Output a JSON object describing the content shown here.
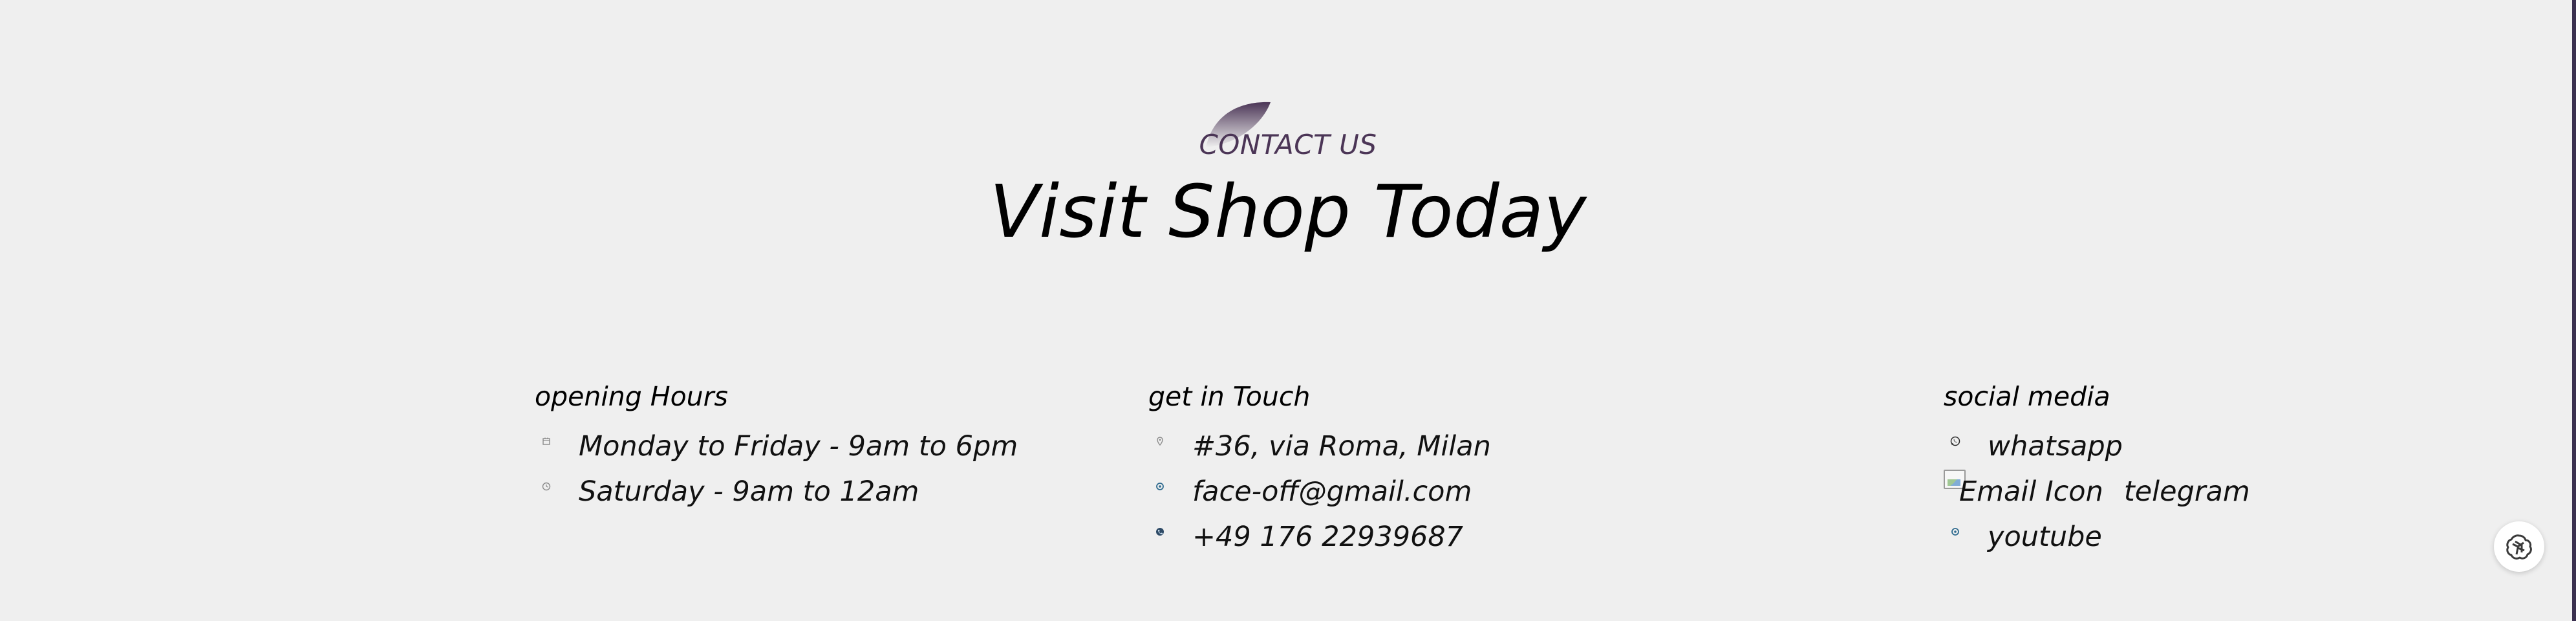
{
  "header": {
    "eyebrow": "CONTACT US",
    "title": "Visit Shop Today"
  },
  "columns": {
    "hours": {
      "heading": "opening Hours",
      "items": [
        {
          "icon": "calendar-icon",
          "text": "Monday to Friday - 9am to 6pm"
        },
        {
          "icon": "clock-icon",
          "text": "Saturday - 9am to 12am"
        }
      ]
    },
    "touch": {
      "heading": "get in Touch",
      "items": [
        {
          "icon": "location-pin-icon",
          "text": "#36, via Roma, Milan"
        },
        {
          "icon": "email-icon",
          "text": "face-off@gmail.com"
        },
        {
          "icon": "phone-icon",
          "text": "+49 176 22939687"
        }
      ]
    },
    "social": {
      "heading": "social media",
      "items": [
        {
          "icon": "whatsapp-icon",
          "text": "whatsapp"
        },
        {
          "icon": "broken-image-icon",
          "alt": "Email Icon",
          "text": "telegram"
        },
        {
          "icon": "youtube-icon",
          "text": "youtube"
        }
      ]
    }
  },
  "colors": {
    "background": "#efefef",
    "accent": "#4b3556",
    "text": "#000000"
  },
  "floating": {
    "icon": "assistant-logo-icon"
  }
}
